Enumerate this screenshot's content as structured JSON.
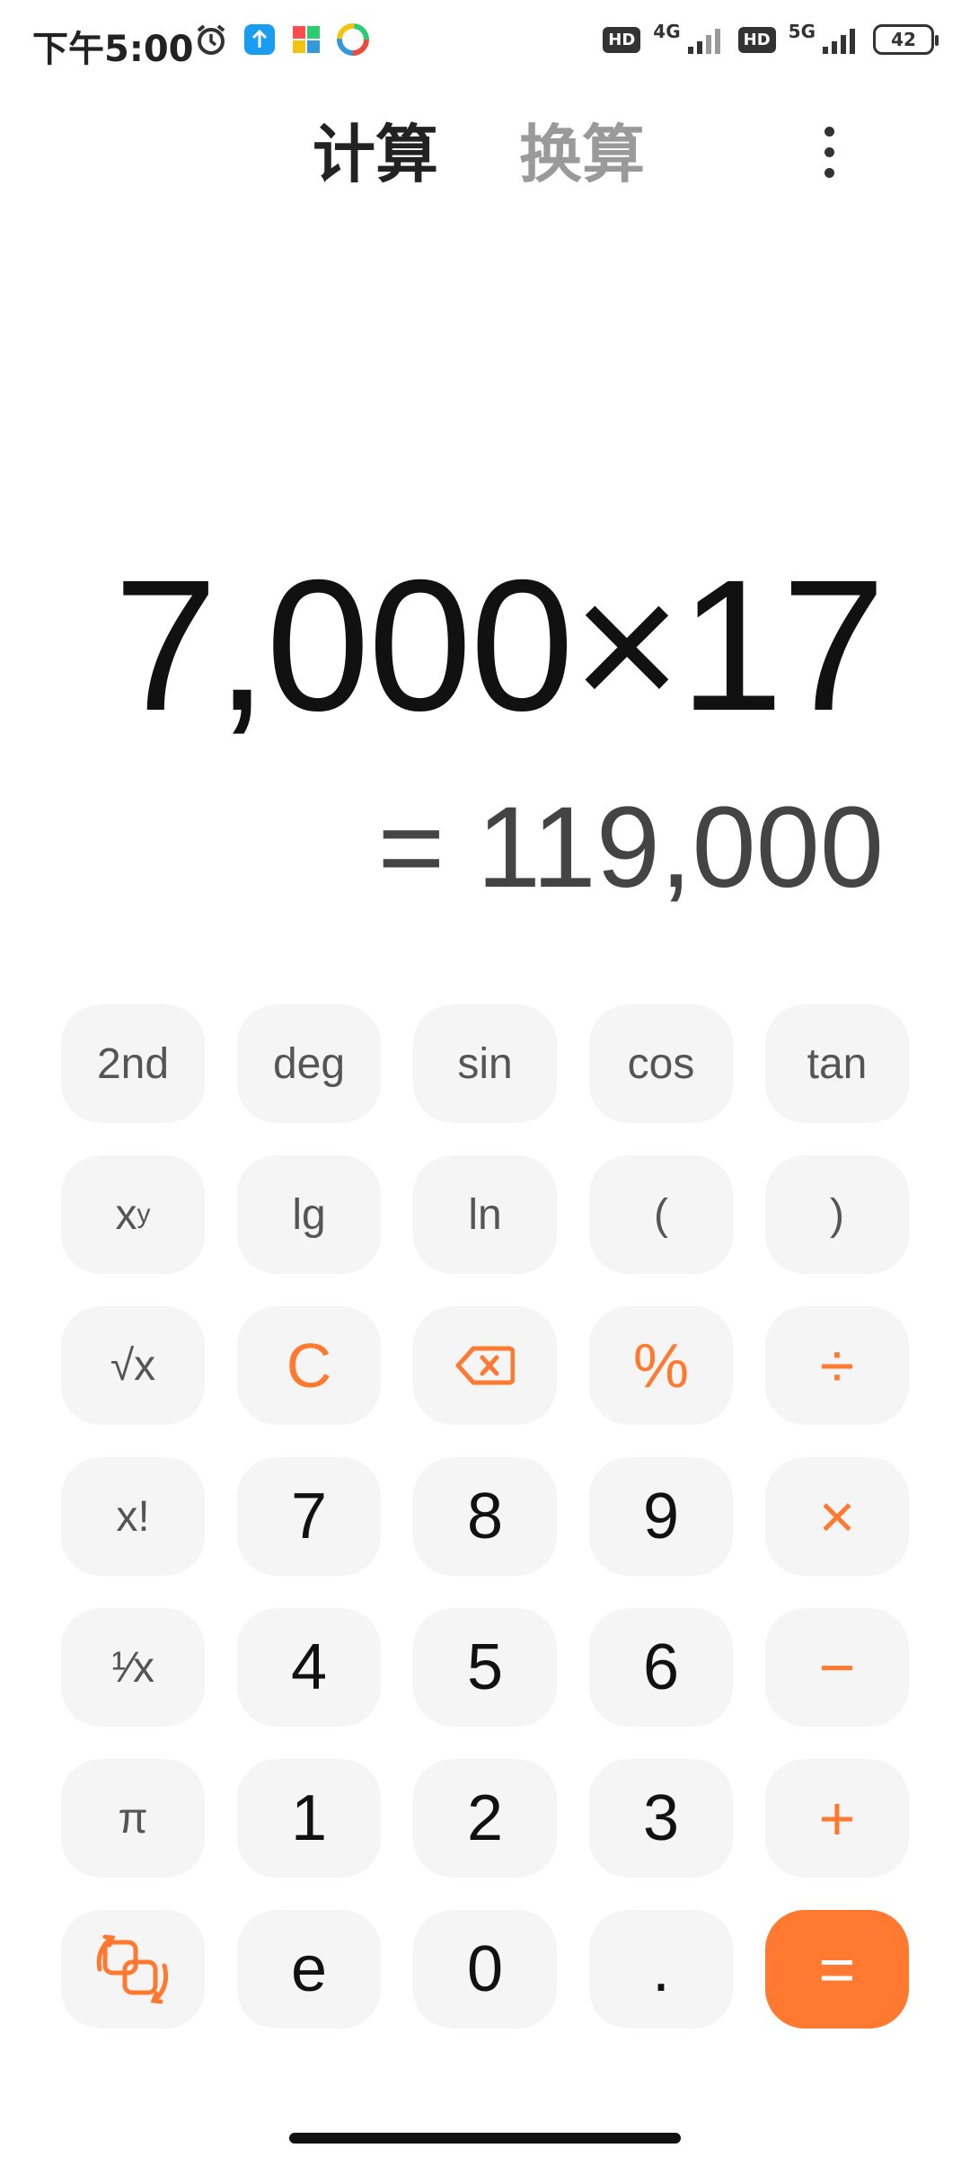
{
  "status_bar": {
    "time": "下午5:00",
    "hd1": "HD",
    "net1": "4G",
    "hd2": "HD",
    "net2": "5G",
    "battery": "42"
  },
  "header": {
    "tab_calc": "计算",
    "tab_convert": "换算"
  },
  "display": {
    "expression": "7,000×17",
    "result": "= 119,000"
  },
  "keys": {
    "second": "2nd",
    "deg": "deg",
    "sin": "sin",
    "cos": "cos",
    "tan": "tan",
    "pow_base": "x",
    "pow_exp": "y",
    "lg": "lg",
    "ln": "ln",
    "lparen": "(",
    "rparen": ")",
    "sqrt": "√x",
    "clear": "C",
    "percent": "%",
    "divide": "÷",
    "factorial": "x!",
    "seven": "7",
    "eight": "8",
    "nine": "9",
    "multiply": "×",
    "reciprocal": "¹⁄x",
    "four": "4",
    "five": "5",
    "six": "6",
    "minus": "−",
    "pi": "π",
    "one": "1",
    "two": "2",
    "three": "3",
    "plus": "+",
    "e": "e",
    "zero": "0",
    "dot": ".",
    "equals": "="
  },
  "colors": {
    "accent": "#ff7a30",
    "key_bg": "#f5f5f5"
  }
}
